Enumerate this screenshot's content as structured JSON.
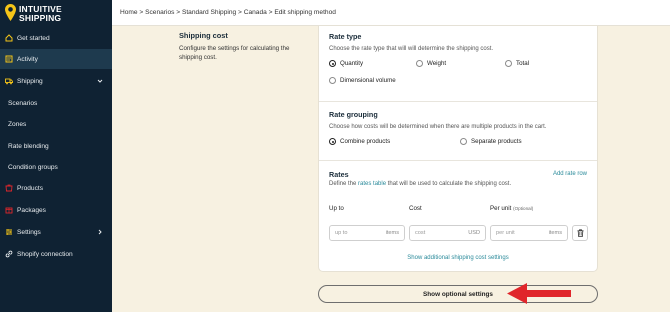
{
  "brand": {
    "line1": "INTUITIVE",
    "line2": "SHIPPING"
  },
  "sidebar": {
    "items": [
      {
        "label": "Get started",
        "icon": "home-icon"
      },
      {
        "label": "Activity",
        "icon": "activity-icon"
      },
      {
        "label": "Shipping",
        "icon": "truck-icon"
      },
      {
        "label": "Scenarios"
      },
      {
        "label": "Zones"
      },
      {
        "label": "Rate blending"
      },
      {
        "label": "Condition groups"
      },
      {
        "label": "Products",
        "icon": "products-icon"
      },
      {
        "label": "Packages",
        "icon": "packages-icon"
      },
      {
        "label": "Settings",
        "icon": "settings-icon"
      },
      {
        "label": "Shopify connection",
        "icon": "link-icon"
      }
    ]
  },
  "breadcrumb": "Home > Scenarios > Standard Shipping > Canada > Edit shipping method",
  "shipping_cost": {
    "title": "Shipping cost",
    "description": "Configure the settings for calculating the shipping cost."
  },
  "rate_type": {
    "title": "Rate type",
    "description": "Choose the rate type that will will determine the shipping cost.",
    "options": [
      "Quantity",
      "Weight",
      "Total",
      "Dimensional volume"
    ],
    "selected": "Quantity"
  },
  "rate_grouping": {
    "title": "Rate grouping",
    "description": "Choose how costs will be determined when there are multiple products in the cart.",
    "options": [
      "Combine products",
      "Separate products"
    ],
    "selected": "Combine products"
  },
  "rates": {
    "title": "Rates",
    "description_prefix": "Define the",
    "description_link": "rates table",
    "description_suffix": "that will be used to calculate the shipping cost.",
    "add_rate": "Add rate row",
    "columns": {
      "up_to": "Up to",
      "cost": "Cost",
      "per_unit": "Per unit",
      "optional": "(Optional)"
    },
    "row": {
      "up_to_placeholder": "up to",
      "up_to_suffix": "items",
      "cost_placeholder": "cost",
      "cost_suffix": "USD",
      "per_unit_placeholder": "per unit",
      "per_unit_suffix": "items"
    },
    "show_additional": "Show additional shipping cost settings"
  },
  "optional_button": "Show optional settings",
  "colors": {
    "sidebar": "#0f2233",
    "accent": "#2a8a9a",
    "arrow": "#e0262b",
    "page_bg": "#f7f1e1",
    "logo": "#f5c518"
  }
}
